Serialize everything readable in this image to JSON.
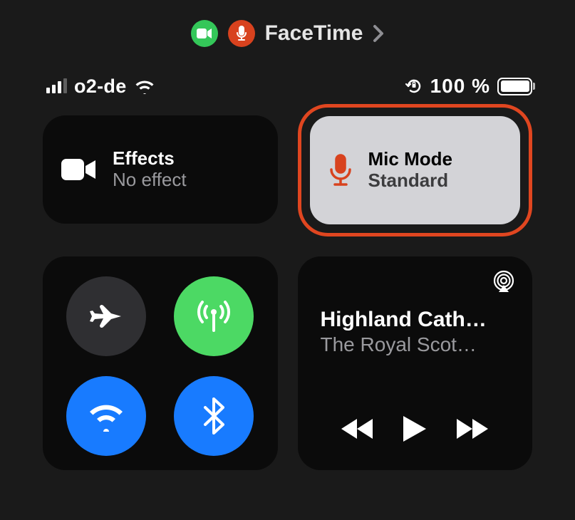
{
  "topBar": {
    "appName": "FaceTime"
  },
  "statusBar": {
    "carrier": "o2-de",
    "batteryPercentText": "100 %",
    "batteryFillPercent": 100,
    "signalBarsActive": 3,
    "signalBarsTotal": 4
  },
  "effectsTile": {
    "title": "Effects",
    "subtitle": "No effect"
  },
  "micModeTile": {
    "title": "Mic Mode",
    "subtitle": "Standard",
    "highlighted": true,
    "highlightColor": "#e04620",
    "iconColor": "#d8421e"
  },
  "connectivity": {
    "airplane": {
      "active": false
    },
    "cellular": {
      "active": true,
      "activeColor": "#4cd964"
    },
    "wifi": {
      "active": true,
      "activeColor": "#187bff"
    },
    "bluetooth": {
      "active": true,
      "activeColor": "#187bff"
    }
  },
  "media": {
    "title": "Highland Cath…",
    "artist": "The Royal Scot…"
  }
}
